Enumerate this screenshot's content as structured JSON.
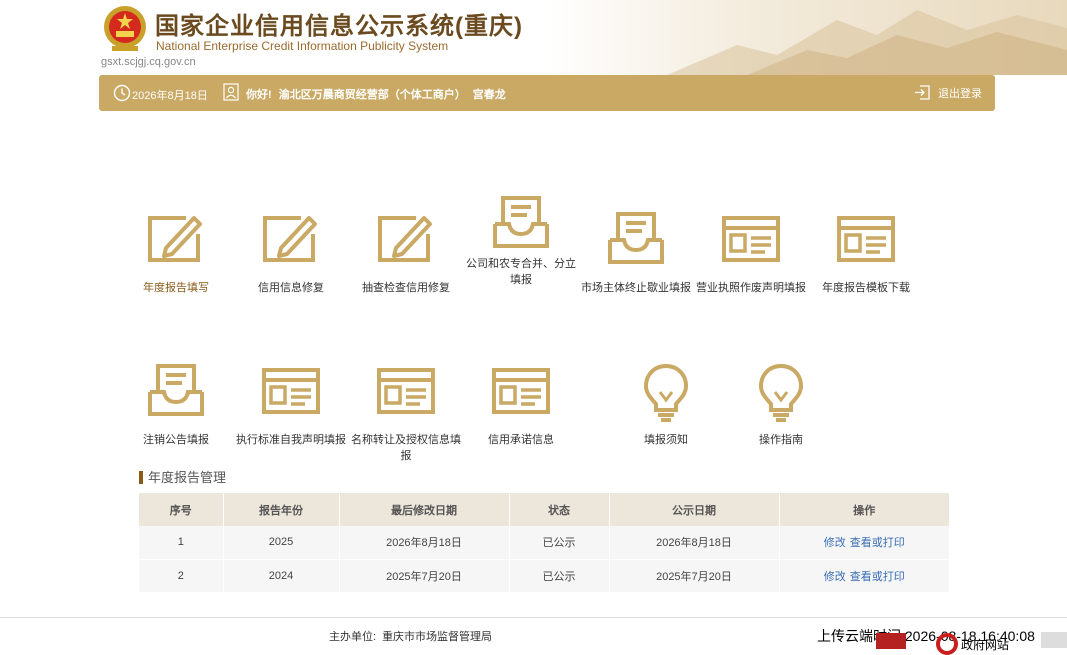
{
  "header": {
    "title": "国家企业信用信息公示系统(重庆)",
    "subtitle_en": "National Enterprise Credit Information Publicity System",
    "domain": "gsxt.scjgj.cq.gov.cn"
  },
  "topbar": {
    "date": "2026年8月18日",
    "greeting": "你好!",
    "entity": "渝北区万晨商贸经营部（个体工商户）",
    "person": "宫春龙",
    "logout": "退出登录",
    "clock_icon": "clock-icon",
    "user_icon": "user-icon",
    "logout_icon": "logout-icon"
  },
  "tiles": [
    {
      "label": "年度报告填写",
      "icon": "edit-icon",
      "active": true
    },
    {
      "label": "信用信息修复",
      "icon": "edit-icon"
    },
    {
      "label": "抽查检查信用修复",
      "icon": "edit-icon"
    },
    {
      "label": "公司和农专合并、分立填报",
      "icon": "inbox-icon"
    },
    {
      "label": "市场主体终止歇业填报",
      "icon": "inbox-icon"
    },
    {
      "label": "营业执照作废声明填报",
      "icon": "form-icon"
    },
    {
      "label": "年度报告模板下载",
      "icon": "form-icon"
    },
    {
      "label": "注销公告填报",
      "icon": "inbox-icon"
    },
    {
      "label": "执行标准自我声明填报",
      "icon": "form-icon"
    },
    {
      "label": "名称转让及授权信息填报",
      "icon": "form-icon"
    },
    {
      "label": "信用承诺信息",
      "icon": "form-icon"
    },
    {
      "label": "填报须知",
      "icon": "bulb-icon"
    },
    {
      "label": "操作指南",
      "icon": "bulb-icon"
    }
  ],
  "annual": {
    "title": "年度报告管理",
    "columns": [
      "序号",
      "报告年份",
      "最后修改日期",
      "状态",
      "公示日期",
      "操作"
    ],
    "rows": [
      {
        "no": "1",
        "year": "2025",
        "modified": "2026年8月18日",
        "status": "已公示",
        "published": "2026年8月18日",
        "edit": "修改",
        "view": "查看或打印"
      },
      {
        "no": "2",
        "year": "2024",
        "modified": "2025年7月20日",
        "status": "已公示",
        "published": "2025年7月20日",
        "edit": "修改",
        "view": "查看或打印"
      }
    ]
  },
  "footer": {
    "host_label": "主办单位:",
    "host": "重庆市市场监督管理局",
    "upload_time": "上传云端时间:2026-08-18 16:40:08",
    "gov_site": "政府网站"
  },
  "colors": {
    "gold": "#c9a964",
    "brown": "#8a5a16",
    "link": "#3b6eb5"
  }
}
